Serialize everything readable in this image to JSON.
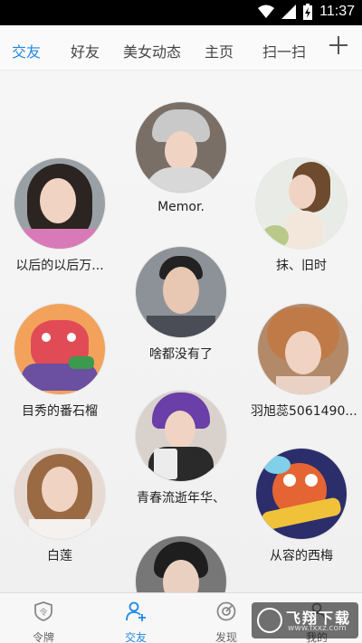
{
  "status_bar": {
    "time": "11:37",
    "icons": [
      "wifi-icon",
      "signal-icon",
      "battery-charging-icon"
    ]
  },
  "nav": {
    "tabs": [
      {
        "label": "交友",
        "active": true
      },
      {
        "label": "好友",
        "active": false
      },
      {
        "label": "美女动态",
        "active": false
      },
      {
        "label": "主页",
        "active": false
      },
      {
        "label": "扫一扫",
        "active": false
      }
    ],
    "add_icon": "plus-icon"
  },
  "people": [
    {
      "name": "Memor."
    },
    {
      "name": "以后的以后万..."
    },
    {
      "name": "抹、旧时"
    },
    {
      "name": "啥都没有了"
    },
    {
      "name": "目秀的番石榴"
    },
    {
      "name": "羽旭蕊5061490..."
    },
    {
      "name": "青春流逝年华、"
    },
    {
      "name": "白莲"
    },
    {
      "name": "从容的西梅"
    },
    {
      "name": ""
    }
  ],
  "bottom_tabs": [
    {
      "label": "令牌",
      "icon": "shield-icon",
      "active": false
    },
    {
      "label": "交友",
      "icon": "user-add-icon",
      "active": true
    },
    {
      "label": "发现",
      "icon": "compass-icon",
      "active": false
    },
    {
      "label": "我的",
      "icon": "profile-icon",
      "active": false
    }
  ],
  "watermark": {
    "title": "飞翔下载",
    "url": "www.fxxz.com"
  },
  "colors": {
    "accent": "#1e88e5",
    "status_bar": "#000000"
  }
}
